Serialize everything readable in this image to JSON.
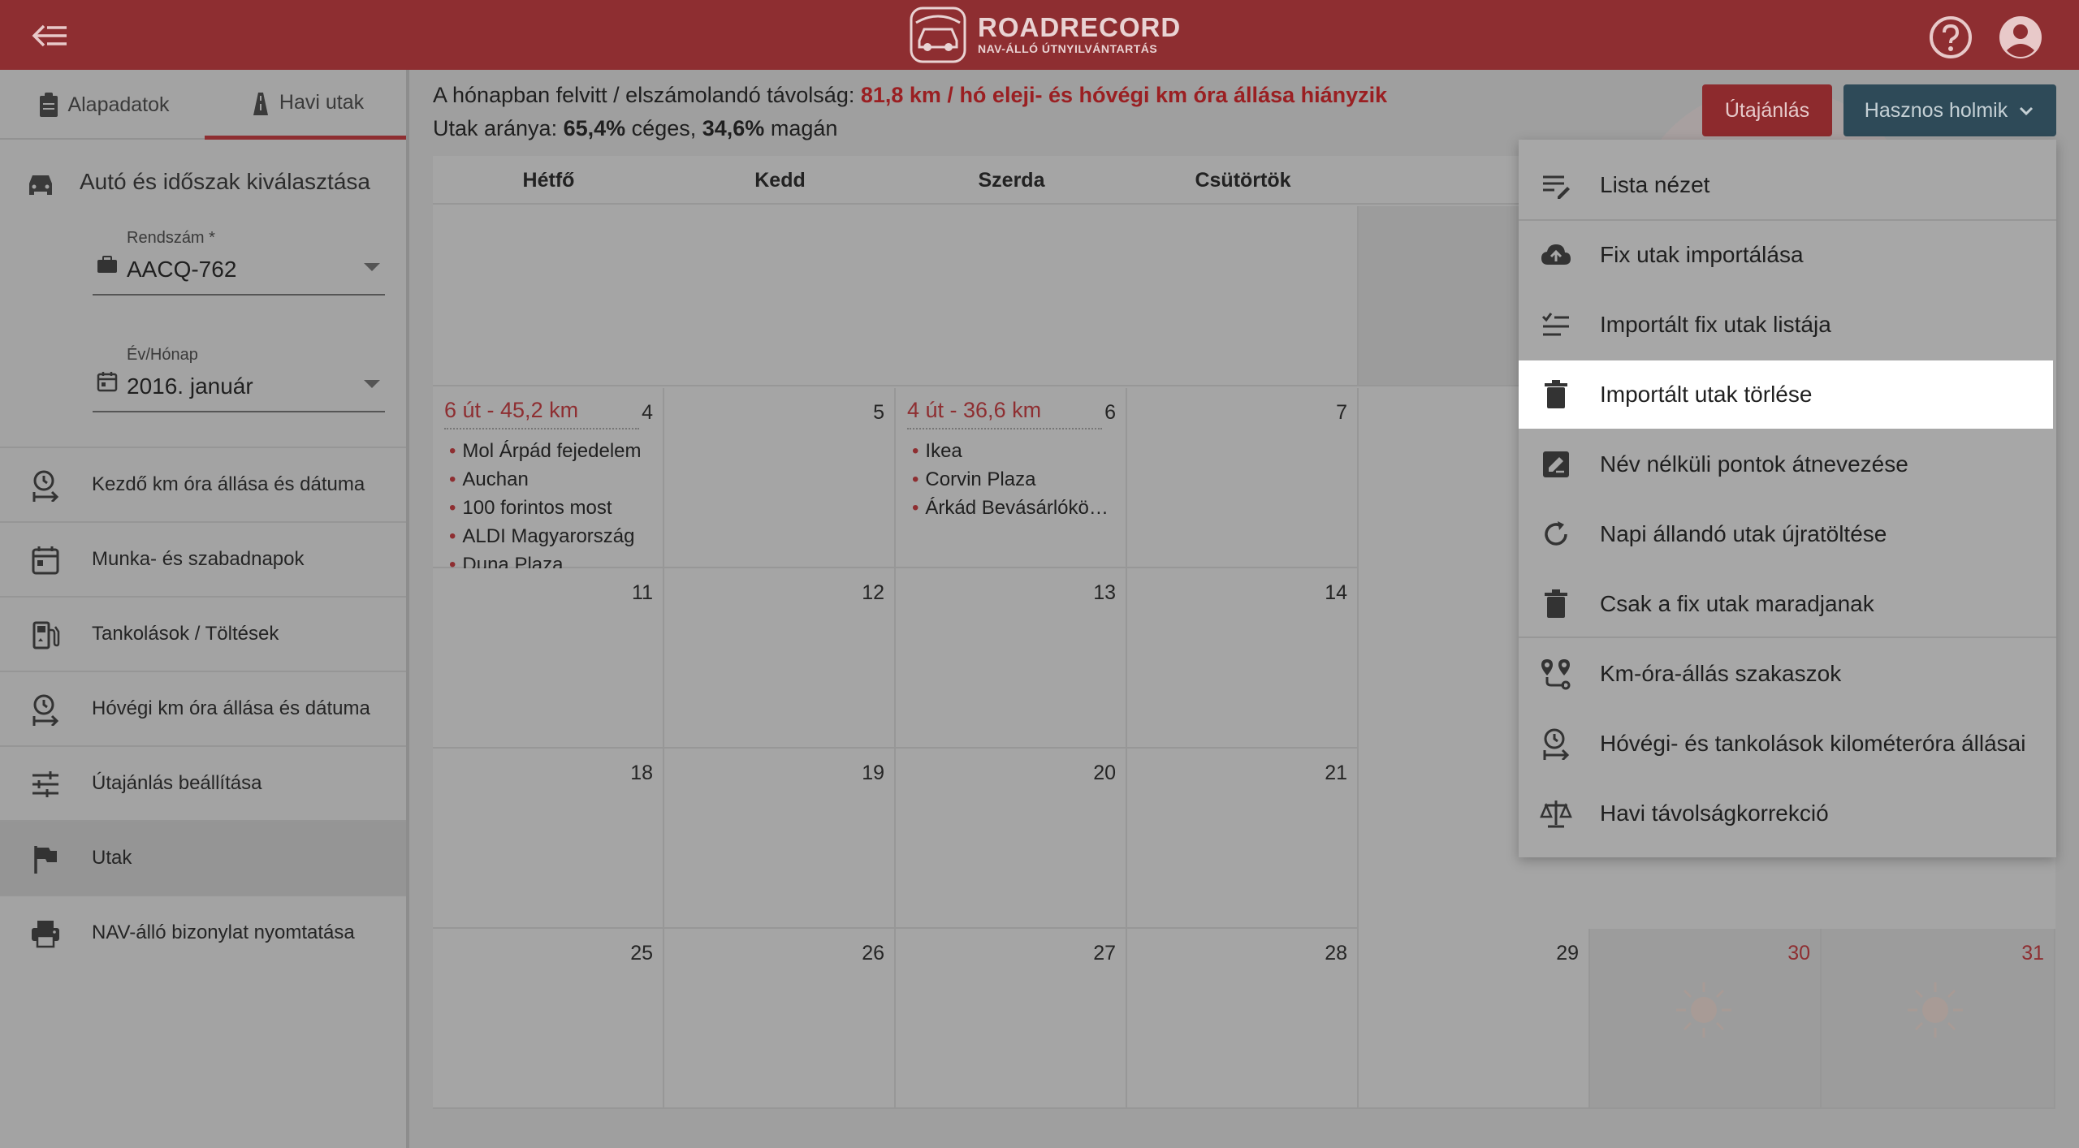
{
  "header": {
    "logo_title": "ROADRECORD",
    "logo_subtitle": "NAV-ÁLLÓ ÚTNYILVÁNTARTÁS"
  },
  "sidebar": {
    "tabs": [
      {
        "label": "Alapadatok",
        "icon": "clipboard-icon"
      },
      {
        "label": "Havi utak",
        "icon": "road-icon"
      }
    ],
    "section_title": "Autó és időszak kiválasztása",
    "plate_field": {
      "label": "Rendszám *",
      "value": "AACQ-762"
    },
    "date_field": {
      "label": "Év/Hónap",
      "value": "2016. január"
    },
    "items": [
      {
        "label": "Kezdő km óra állása és dátuma",
        "icon": "clock-arrow-icon"
      },
      {
        "label": "Munka- és szabadnapok",
        "icon": "calendar-icon"
      },
      {
        "label": "Tankolások / Töltések",
        "icon": "fuel-icon"
      },
      {
        "label": "Hóvégi km óra állása és dátuma",
        "icon": "clock-arrow-icon"
      },
      {
        "label": "Útajánlás beállítása",
        "icon": "sliders-icon"
      },
      {
        "label": "Utak",
        "icon": "flag-icon"
      },
      {
        "label": "NAV-álló bizonylat nyomtatása",
        "icon": "printer-icon"
      }
    ]
  },
  "summary": {
    "line1_prefix": "A hónapban felvitt / elszámolandó távolság:",
    "line1_value": "81,8 km / hó eleji- és hóvégi km óra állása hiányzik",
    "line2_prefix": "Utak aránya:",
    "line2_company": "65,4%",
    "line2_company_label": "céges,",
    "line2_private": "34,6%",
    "line2_private_label": "magán"
  },
  "buttons": {
    "plan": "Útajánlás",
    "useful": "Hasznos holmik"
  },
  "calendar": {
    "weekdays": [
      "Hétfő",
      "Kedd",
      "Szerda",
      "Csütörtök"
    ],
    "days": {
      "d4": "4",
      "d5": "5",
      "d6": "6",
      "d7": "7",
      "d11": "11",
      "d12": "12",
      "d13": "13",
      "d14": "14",
      "d18": "18",
      "d19": "19",
      "d20": "20",
      "d21": "21",
      "d25": "25",
      "d26": "26",
      "d27": "27",
      "d28": "28",
      "d29": "29",
      "d30": "30",
      "d31": "31"
    },
    "monday4": {
      "header": "6 út - 45,2 km",
      "trips": [
        "Mol Árpád fejedelem",
        "Auchan",
        "100 forintos most",
        "ALDI Magyarország",
        "Duna Plaza"
      ]
    },
    "wednesday6": {
      "header": "4 út - 36,6 km",
      "trips": [
        "Ikea",
        "Corvin Plaza",
        "Árkád Bevásárlóközpont"
      ]
    }
  },
  "dropdown": {
    "items": [
      {
        "label": "Lista nézet",
        "icon": "list-edit-icon"
      },
      {
        "label": "Fix utak importálása",
        "icon": "cloud-upload-icon"
      },
      {
        "label": "Importált fix utak listája",
        "icon": "checklist-icon"
      },
      {
        "label": "Importált utak törlése",
        "icon": "trash-icon"
      },
      {
        "label": "Név nélküli pontok átnevezése",
        "icon": "edit-box-icon"
      },
      {
        "label": "Napi állandó utak újratöltése",
        "icon": "refresh-icon"
      },
      {
        "label": "Csak a fix utak maradjanak",
        "icon": "trash-icon"
      },
      {
        "label": "Km-óra-állás szakaszok",
        "icon": "route-pins-icon"
      },
      {
        "label": "Hóvégi- és tankolások kilométeróra állásai",
        "icon": "clock-arrow-icon"
      },
      {
        "label": "Havi távolságkorrekció",
        "icon": "balance-icon"
      }
    ]
  }
}
